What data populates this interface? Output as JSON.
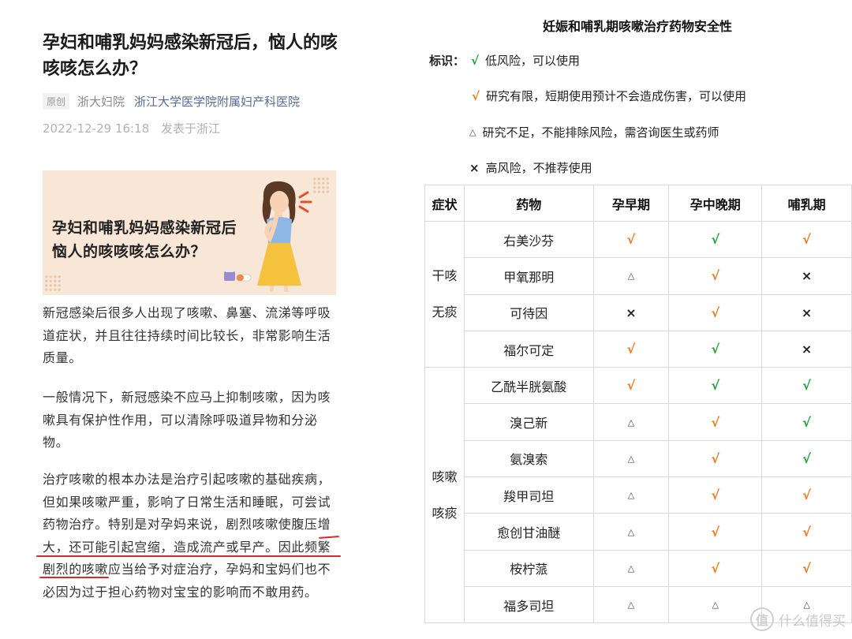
{
  "article": {
    "title": "孕妇和哺乳妈妈感染新冠后，恼人的咳咳咳怎么办？",
    "badge": "原创",
    "author": "浙大妇院",
    "account": "浙江大学医学院附属妇产科医院",
    "date": "2022-12-29 16:18",
    "location": "发表于浙江",
    "banner_line1": "孕妇和哺乳妈妈感染新冠后",
    "banner_line2": "恼人的咳咳咳怎么办？",
    "para1": "新冠感染后很多人出现了咳嗽、鼻塞、流涕等呼吸道症状，并且往往持续时间比较长，非常影响生活质量。",
    "para2": "一般情况下，新冠感染不应马上抑制咳嗽，因为咳嗽具有保护性作用，可以清除呼吸道异物和分泌物。",
    "para3": "治疗咳嗽的根本办法是治疗引起咳嗽的基础疾病，但如果咳嗽严重，影响了日常生活和睡眠，可尝试药物治疗。特别是对孕妈来说，剧烈咳嗽使腹压增大，还可能引起宫缩，造成流产或早产。因此频繁剧烈的咳嗽应当给予对症治疗，孕妈和宝妈们也不必因为过于担心药物对宝宝的影响而不敢用药。"
  },
  "panel": {
    "title": "妊娠和哺乳期咳嗽治疗药物安全性",
    "legend_key": "标识：",
    "legend": [
      {
        "symbol": "√",
        "color": "green",
        "text": "低风险，可以使用"
      },
      {
        "symbol": "√",
        "color": "orange",
        "text": "研究有限，短期使用预计不会造成伤害，可以使用"
      },
      {
        "symbol": "△",
        "color": "tri",
        "text": "研究不足，不能排除风险，需咨询医生或药师"
      },
      {
        "symbol": "×",
        "color": "cross",
        "text": "高风险，不推荐使用"
      }
    ],
    "headers": [
      "症状",
      "药物",
      "孕早期",
      "孕中晚期",
      "哺乳期"
    ],
    "groups": [
      {
        "symptom_line1": "干咳",
        "symptom_line2": "无痰",
        "rows": [
          {
            "drug": "右美沙芬",
            "cells": [
              "orange-check",
              "green-check",
              "orange-check"
            ]
          },
          {
            "drug": "甲氧那明",
            "cells": [
              "triangle",
              "orange-check",
              "cross"
            ]
          },
          {
            "drug": "可待因",
            "cells": [
              "cross",
              "orange-check",
              "cross"
            ]
          },
          {
            "drug": "福尔可定",
            "cells": [
              "orange-check",
              "green-check",
              "cross"
            ]
          }
        ]
      },
      {
        "symptom_line1": "咳嗽",
        "symptom_line2": "咳痰",
        "rows": [
          {
            "drug": "乙酰半胱氨酸",
            "cells": [
              "orange-check",
              "green-check",
              "green-check"
            ]
          },
          {
            "drug": "溴己新",
            "cells": [
              "triangle",
              "orange-check",
              "green-check"
            ]
          },
          {
            "drug": "氨溴索",
            "cells": [
              "triangle",
              "orange-check",
              "green-check"
            ]
          },
          {
            "drug": "羧甲司坦",
            "cells": [
              "triangle",
              "orange-check",
              "orange-check"
            ]
          },
          {
            "drug": "愈创甘油醚",
            "cells": [
              "triangle",
              "orange-check",
              "orange-check"
            ]
          },
          {
            "drug": "桉柠蒎",
            "cells": [
              "triangle",
              "orange-check",
              "orange-check"
            ]
          },
          {
            "drug": "福多司坦",
            "cells": [
              "triangle",
              "triangle",
              "triangle"
            ]
          }
        ]
      }
    ],
    "symbols": {
      "check": "√",
      "triangle": "△",
      "cross": "×"
    },
    "colors": {
      "green": "#1fa23a",
      "orange": "#ee7b1d"
    }
  },
  "watermark": {
    "icon": "值",
    "text": "什么值得买"
  }
}
